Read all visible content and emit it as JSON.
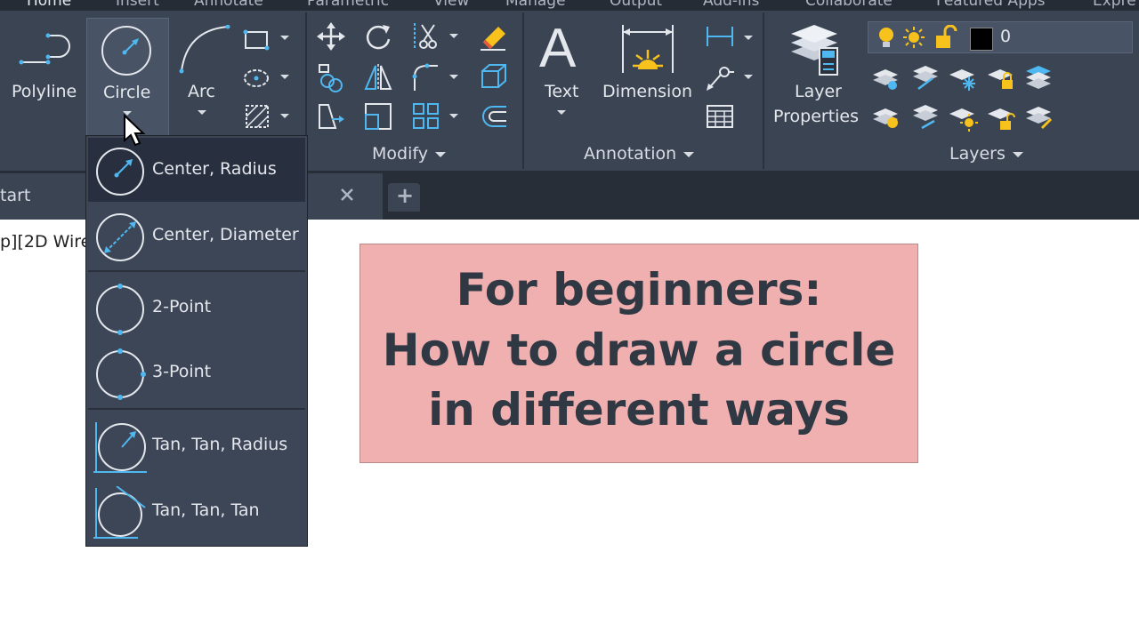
{
  "menu_tabs": [
    "Home",
    "Insert",
    "Annotate",
    "Parametric",
    "View",
    "Manage",
    "Output",
    "Add-ins",
    "Collaborate",
    "Featured Apps",
    "Expre"
  ],
  "draw_tools": {
    "polyline": "Polyline",
    "circle": "Circle",
    "arc": "Arc"
  },
  "panels": {
    "modify": "Modify",
    "annotation": "Annotation",
    "layers": "Layers"
  },
  "annotation_tools": {
    "text": "Text",
    "dimension": "Dimension"
  },
  "layer_properties": {
    "line1": "Layer",
    "line2": "Properties"
  },
  "layer_dropdown": {
    "current_layer": "0",
    "swatch_color": "#000000"
  },
  "file_tabs": {
    "start_tab": "tart",
    "new_tab_symbol": "+"
  },
  "viewport_label": "p][2D Wire",
  "circle_menu": {
    "items": [
      {
        "label": "Center, Radius",
        "icon": "circle-center-radius-icon"
      },
      {
        "label": "Center, Diameter",
        "icon": "circle-center-diameter-icon"
      },
      {
        "label": "2-Point",
        "icon": "circle-2-point-icon"
      },
      {
        "label": "3-Point",
        "icon": "circle-3-point-icon"
      },
      {
        "label": "Tan, Tan, Radius",
        "icon": "circle-tan-tan-radius-icon"
      },
      {
        "label": "Tan, Tan, Tan",
        "icon": "circle-tan-tan-tan-icon"
      }
    ],
    "highlighted_item": "Center, Radius"
  },
  "banner": {
    "line1": "For beginners:",
    "line2": "How to draw a circle",
    "line3": "in different ways",
    "background": "#f0b0b0",
    "text_color": "#2f3843"
  },
  "colors": {
    "ribbon_bg": "#3b4453",
    "icon_blue": "#4fb8f0",
    "icon_yellow": "#f6c21b"
  }
}
